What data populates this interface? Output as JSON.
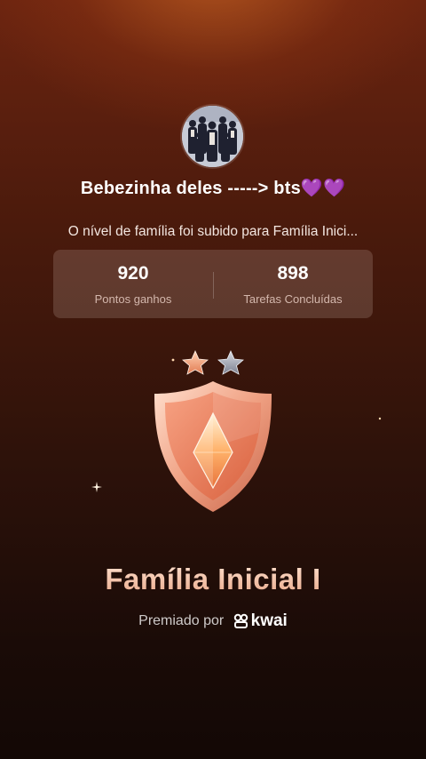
{
  "profile": {
    "username": "Bebezinha deles -----> bts💜💜"
  },
  "level_message": "O nível de família foi subido para Família Inici...",
  "stats": {
    "points_value": "920",
    "points_label": "Pontos ganhos",
    "tasks_value": "898",
    "tasks_label": "Tarefas Concluídas"
  },
  "badge": {
    "stars_filled": 1,
    "stars_total": 2,
    "icon": "shield-badge-icon"
  },
  "level_title": "Família Inicial I",
  "awarded": {
    "label": "Premiado por",
    "brand": "kwai"
  },
  "colors": {
    "background_top": "#6b2410",
    "background_bottom": "#130805",
    "title_gradient_start": "#ffe1cf",
    "title_gradient_end": "#e9a98a",
    "badge_main": "#e98a6c"
  }
}
